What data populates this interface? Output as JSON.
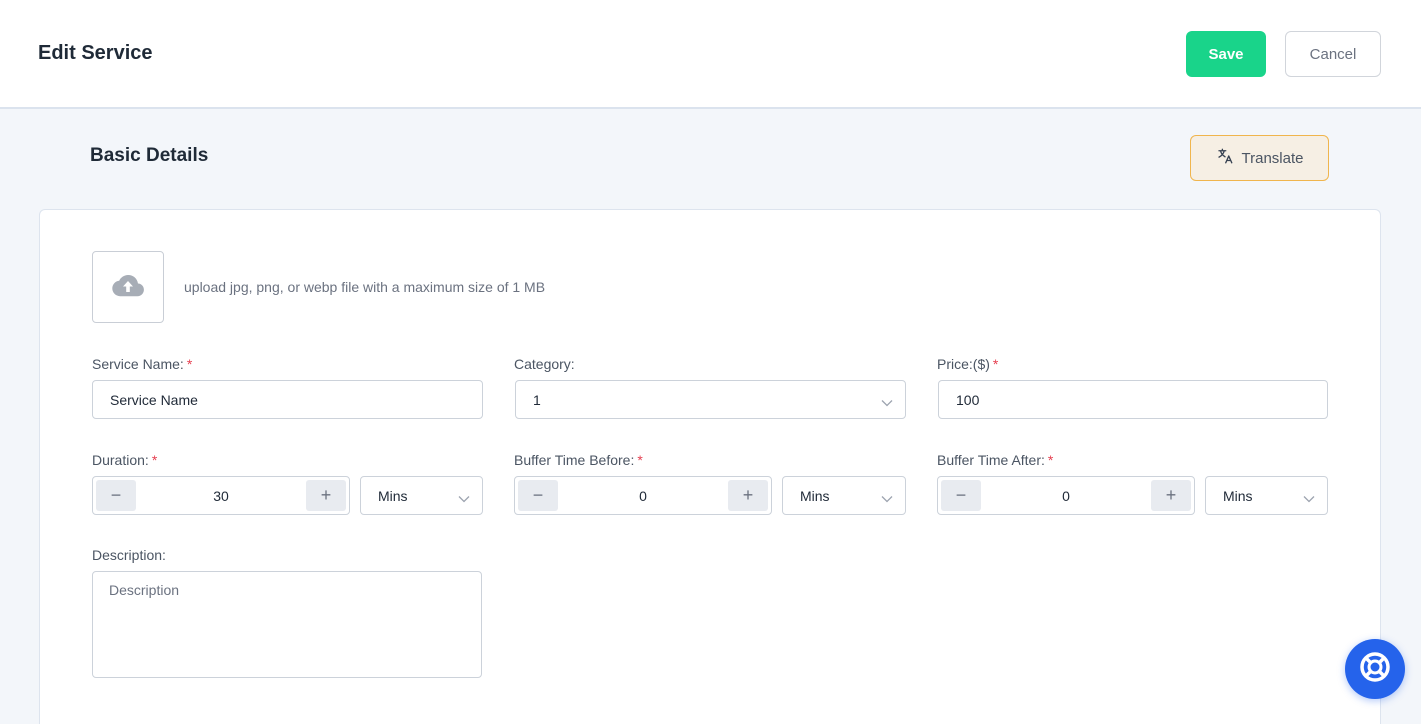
{
  "header": {
    "title": "Edit Service",
    "save_label": "Save",
    "cancel_label": "Cancel"
  },
  "section": {
    "title": "Basic Details",
    "translate_label": "Translate"
  },
  "upload": {
    "hint": "upload jpg, png, or webp file with a maximum size of 1 MB",
    "icon": "cloud-upload-icon"
  },
  "fields": {
    "service_name": {
      "label": "Service Name:",
      "required_mark": "*",
      "value": "Service Name"
    },
    "category": {
      "label": "Category:",
      "value": "1"
    },
    "price": {
      "label": "Price:($)",
      "required_mark": "*",
      "value": "100"
    },
    "duration": {
      "label": "Duration:",
      "required_mark": "*",
      "value": "30",
      "unit": "Mins"
    },
    "buffer_before": {
      "label": "Buffer Time Before:",
      "required_mark": "*",
      "value": "0",
      "unit": "Mins"
    },
    "buffer_after": {
      "label": "Buffer Time After:",
      "required_mark": "*",
      "value": "0",
      "unit": "Mins"
    },
    "description": {
      "label": "Description:",
      "placeholder": "Description"
    }
  },
  "stepper_symbols": {
    "minus": "−",
    "plus": "+"
  },
  "colors": {
    "save": "#19d48a",
    "translate_border": "#f0b54d",
    "required": "#e53e4f",
    "help": "#2563eb"
  }
}
